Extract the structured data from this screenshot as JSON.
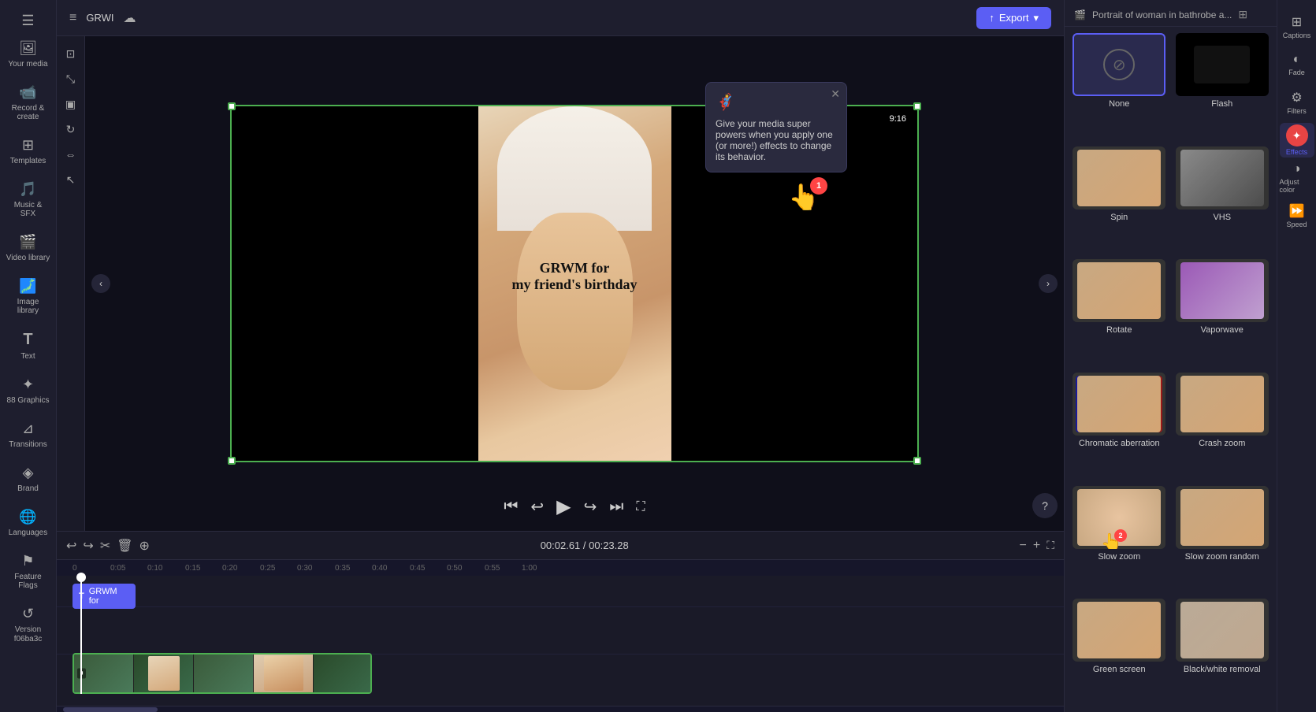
{
  "app": {
    "title": "GRWI",
    "export_label": "Export"
  },
  "sidebar": {
    "items": [
      {
        "id": "your-media",
        "label": "Your media",
        "icon": "🖼"
      },
      {
        "id": "record-create",
        "label": "Record &\ncreate",
        "icon": "📹"
      },
      {
        "id": "templates",
        "label": "Templates",
        "icon": "⊞"
      },
      {
        "id": "music-sfx",
        "label": "Music & SFX",
        "icon": "🎵"
      },
      {
        "id": "video-library",
        "label": "Video library",
        "icon": "🎬"
      },
      {
        "id": "image-library",
        "label": "Image library",
        "icon": "🗾"
      },
      {
        "id": "text",
        "label": "Text",
        "icon": "T"
      },
      {
        "id": "graphics",
        "label": "88 Graphics",
        "icon": "✦"
      },
      {
        "id": "transitions",
        "label": "Transitions",
        "icon": "⊿"
      },
      {
        "id": "brand",
        "label": "Brand",
        "icon": "◈"
      },
      {
        "id": "languages",
        "label": "Languages",
        "icon": "🌐"
      },
      {
        "id": "feature-flags",
        "label": "Feature Flags",
        "icon": "⚑"
      },
      {
        "id": "version",
        "label": "Version\nf06ba3c",
        "icon": "↺"
      }
    ]
  },
  "canvas": {
    "aspect_ratio": "9:16",
    "video_text_line1": "GRWM for",
    "video_text_line2": "my friend's birthday",
    "time_current": "00:02.61",
    "time_total": "00:23.28"
  },
  "transform_tools": [
    {
      "id": "crop",
      "icon": "⊡"
    },
    {
      "id": "resize",
      "icon": "⤡"
    },
    {
      "id": "monitor",
      "icon": "▣"
    },
    {
      "id": "rotate-tool",
      "icon": "↻"
    },
    {
      "id": "mirror",
      "icon": "⇔"
    },
    {
      "id": "arrow-tool",
      "icon": "↖"
    }
  ],
  "tooltip_popup": {
    "emoji": "🦸",
    "text": "Give your media super powers when you apply one (or more!) effects to change its behavior."
  },
  "effects": {
    "panel_title": "Portrait of woman in bathrobe a...",
    "items": [
      {
        "id": "none",
        "label": "None",
        "type": "none",
        "selected": true
      },
      {
        "id": "flash",
        "label": "Flash",
        "type": "flash"
      },
      {
        "id": "spin",
        "label": "Spin",
        "type": "spin"
      },
      {
        "id": "vhs",
        "label": "VHS",
        "type": "vhs"
      },
      {
        "id": "rotate",
        "label": "Rotate",
        "type": "rotate"
      },
      {
        "id": "vaporwave",
        "label": "Vaporwave",
        "type": "vaporwave"
      },
      {
        "id": "chromatic-aberration",
        "label": "Chromatic aberration",
        "type": "chromatic"
      },
      {
        "id": "crash-zoom",
        "label": "Crash zoom",
        "type": "crash"
      },
      {
        "id": "slow-zoom",
        "label": "Slow zoom",
        "type": "slowzoom"
      },
      {
        "id": "slow-zoom-random",
        "label": "Slow zoom random",
        "type": "slowzoom-random"
      },
      {
        "id": "green-screen",
        "label": "Green screen",
        "type": "green"
      },
      {
        "id": "black-white-removal",
        "label": "Black/white removal",
        "type": "bw"
      }
    ]
  },
  "right_toolbar": [
    {
      "id": "captions",
      "label": "Captions",
      "icon": "⊞"
    },
    {
      "id": "fade",
      "label": "Fade",
      "icon": "◐"
    },
    {
      "id": "filters",
      "label": "Filters",
      "icon": "⚙"
    },
    {
      "id": "effects",
      "label": "Effects",
      "icon": "✦",
      "active": true
    },
    {
      "id": "color",
      "label": "Adjust color",
      "icon": "◑"
    },
    {
      "id": "speed",
      "label": "Speed",
      "icon": "⏩"
    }
  ],
  "timeline": {
    "time_display": "00:02.61 / 00:23.28",
    "markers": [
      "0:00",
      "0:05",
      "0:10",
      "0:15",
      "0:20",
      "0:25",
      "0:30",
      "0:35",
      "0:40",
      "0:45",
      "0:50",
      "0:55",
      "1:00"
    ],
    "text_track_label": "GRWM for",
    "video_track_count": 5
  }
}
